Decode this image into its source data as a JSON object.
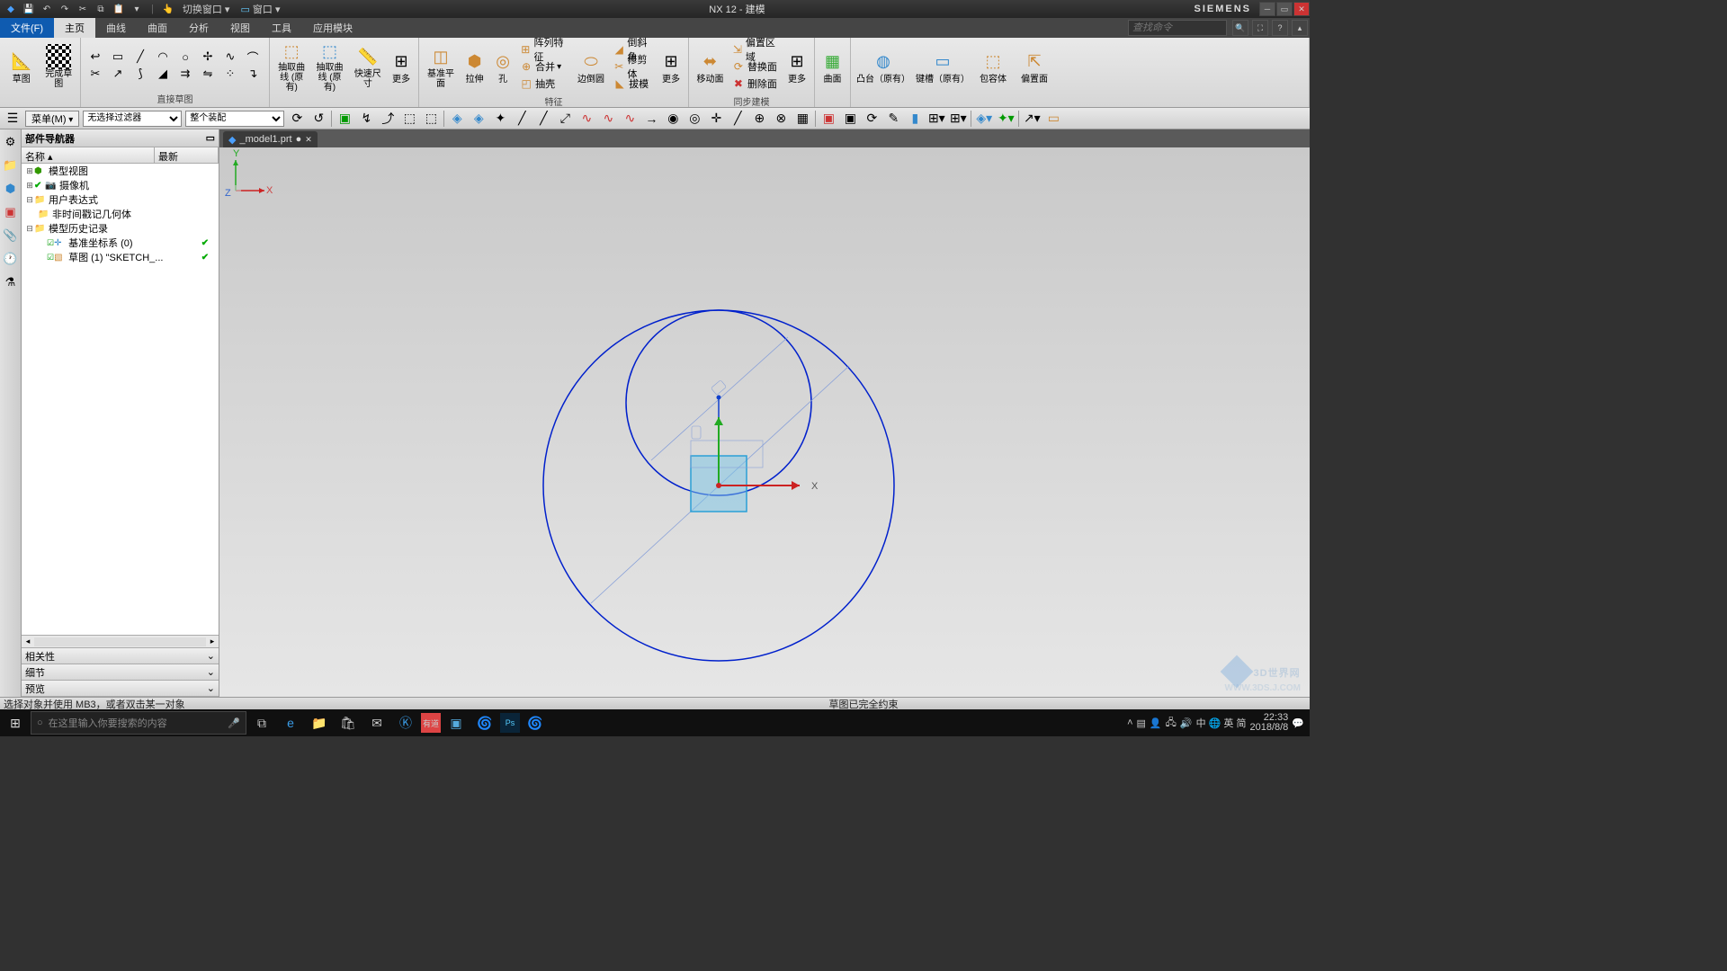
{
  "title": "NX 12 - 建模",
  "brand": "SIEMENS",
  "qat_menus": {
    "switch_window": "切换窗口",
    "window": "窗口"
  },
  "menubar": {
    "file": "文件(F)",
    "tabs": [
      "主页",
      "曲线",
      "曲面",
      "分析",
      "视图",
      "工具",
      "应用模块"
    ],
    "active_index": 0,
    "search_placeholder": "查找命令"
  },
  "ribbon": {
    "group_sketch": {
      "sketch": "草图",
      "finish_sketch": "完成草图",
      "title": "直接草图"
    },
    "group_feature": {
      "datum_plane": "基准平面",
      "extrude": "拉伸",
      "hole": "孔",
      "pattern": "阵列特征",
      "unite": "合并",
      "shell": "抽壳",
      "edge_blend": "边倒圆",
      "draft": "倒斜角",
      "trim_body": "修剪体",
      "draft2": "拔模",
      "more": "更多",
      "title": "特征"
    },
    "group_sync": {
      "move_face": "移动面",
      "offset_region": "偏置区域",
      "replace_face": "替换面",
      "delete_face": "删除面",
      "more": "更多",
      "title": "同步建模"
    },
    "group_surface": {
      "surface": "曲面"
    },
    "group_derive": {
      "extract_geom": "抽取曲线 (原有)",
      "rapid_dim": "快速尺寸",
      "more": "更多"
    },
    "group_last": {
      "boss": "凸台（原有）",
      "keyway": "键槽（原有）",
      "bounding": "包容体",
      "offset_face": "偏置面"
    }
  },
  "toolbar2": {
    "menu_btn": "菜单(M)",
    "filter": "无选择过滤器",
    "assembly": "整个装配"
  },
  "navigator": {
    "title": "部件导航器",
    "col_name": "名称",
    "col_latest": "最新",
    "tree": {
      "model_views": "模型视图",
      "cameras": "摄像机",
      "user_expr": "用户表达式",
      "non_ts_geom": "非时间戳记几何体",
      "history": "模型历史记录",
      "datum_csys": "基准坐标系 (0)",
      "sketch": "草图 (1) \"SKETCH_..."
    },
    "sections": {
      "dependency": "相关性",
      "details": "细节",
      "preview": "预览"
    }
  },
  "file_tab": "_model1.prt",
  "axes": {
    "x": "X",
    "y": "Y",
    "z": "Z"
  },
  "status": {
    "left": "选择对象并使用 MB3，或者双击某一对象",
    "center": "草图已完全约束"
  },
  "taskbar": {
    "search_placeholder": "在这里输入你要搜索的内容",
    "ime": "中 🌐 英 简",
    "time": "22:33",
    "date": "2018/8/8"
  },
  "watermark": "3D世界网",
  "watermark_url": "WWW.3DS.J.COM"
}
